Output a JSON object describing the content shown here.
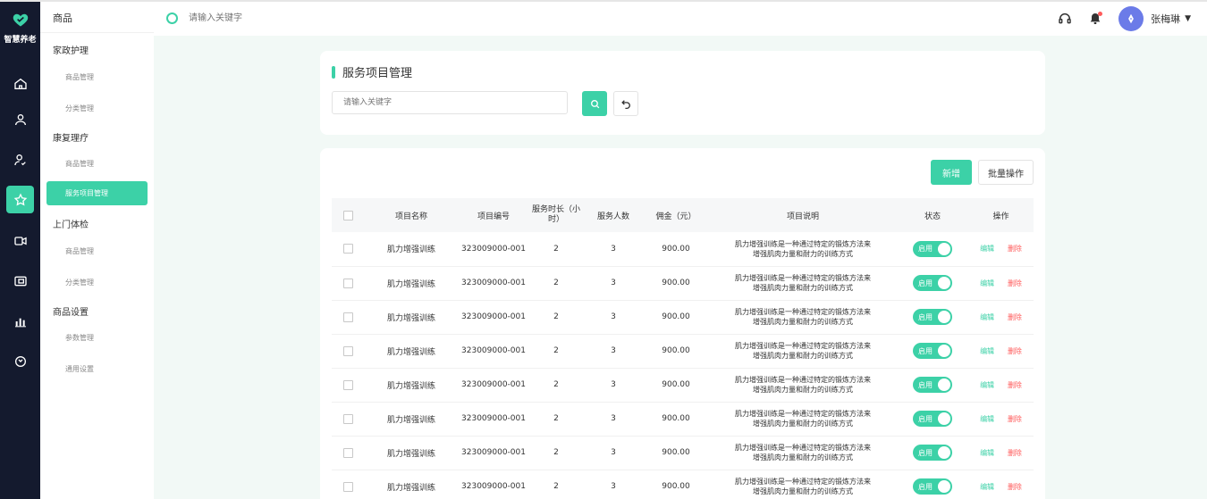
{
  "brand": {
    "name": "智慧养老"
  },
  "rail": {
    "items": [
      {
        "icon": "home-icon"
      },
      {
        "icon": "user-icon"
      },
      {
        "icon": "user-check-icon"
      },
      {
        "icon": "star-icon",
        "active": true
      },
      {
        "icon": "video-icon"
      },
      {
        "icon": "wallet-icon"
      },
      {
        "icon": "bar-chart-icon"
      },
      {
        "icon": "clock-icon"
      }
    ]
  },
  "submenu": {
    "title": "商品",
    "groups": [
      {
        "label": "家政护理",
        "items": [
          "商品管理",
          "分类管理"
        ]
      },
      {
        "label": "康复理疗",
        "items": [
          "商品管理",
          "服务项目管理"
        ]
      },
      {
        "label": "上门体检",
        "items": [
          "商品管理",
          "分类管理"
        ]
      },
      {
        "label": "商品设置",
        "items": [
          "参数管理",
          "通用设置"
        ]
      }
    ],
    "active_item": "服务项目管理"
  },
  "topbar": {
    "search_placeholder": "请输入关键字",
    "user_name": "张梅琳"
  },
  "filter": {
    "title": "服务项目管理",
    "keyword_placeholder": "请输入关键字"
  },
  "toolbar": {
    "add_label": "新增",
    "batch_label": "批量操作"
  },
  "table": {
    "headers": [
      "项目名称",
      "项目编号",
      "服务时长（小时）",
      "服务人数",
      "佣金（元）",
      "项目说明",
      "状态",
      "操作"
    ],
    "rows": [
      {
        "name": "肌力增强训练",
        "code": "323009000-001",
        "hours": "2",
        "people": "3",
        "fee": "900.00",
        "desc_line1": "肌力增强训练是一种通过特定的锻炼方法来",
        "desc_line2": "增强肌肉力量和耐力的训练方式",
        "status": "启用",
        "edit": "编辑",
        "delete": "删除"
      },
      {
        "name": "肌力增强训练",
        "code": "323009000-001",
        "hours": "2",
        "people": "3",
        "fee": "900.00",
        "desc_line1": "肌力增强训练是一种通过特定的锻炼方法来",
        "desc_line2": "增强肌肉力量和耐力的训练方式",
        "status": "启用",
        "edit": "编辑",
        "delete": "删除"
      },
      {
        "name": "肌力增强训练",
        "code": "323009000-001",
        "hours": "2",
        "people": "3",
        "fee": "900.00",
        "desc_line1": "肌力增强训练是一种通过特定的锻炼方法来",
        "desc_line2": "增强肌肉力量和耐力的训练方式",
        "status": "启用",
        "edit": "编辑",
        "delete": "删除"
      },
      {
        "name": "肌力增强训练",
        "code": "323009000-001",
        "hours": "2",
        "people": "3",
        "fee": "900.00",
        "desc_line1": "肌力增强训练是一种通过特定的锻炼方法来",
        "desc_line2": "增强肌肉力量和耐力的训练方式",
        "status": "启用",
        "edit": "编辑",
        "delete": "删除"
      },
      {
        "name": "肌力增强训练",
        "code": "323009000-001",
        "hours": "2",
        "people": "3",
        "fee": "900.00",
        "desc_line1": "肌力增强训练是一种通过特定的锻炼方法来",
        "desc_line2": "增强肌肉力量和耐力的训练方式",
        "status": "启用",
        "edit": "编辑",
        "delete": "删除"
      },
      {
        "name": "肌力增强训练",
        "code": "323009000-001",
        "hours": "2",
        "people": "3",
        "fee": "900.00",
        "desc_line1": "肌力增强训练是一种通过特定的锻炼方法来",
        "desc_line2": "增强肌肉力量和耐力的训练方式",
        "status": "启用",
        "edit": "编辑",
        "delete": "删除"
      },
      {
        "name": "肌力增强训练",
        "code": "323009000-001",
        "hours": "2",
        "people": "3",
        "fee": "900.00",
        "desc_line1": "肌力增强训练是一种通过特定的锻炼方法来",
        "desc_line2": "增强肌肉力量和耐力的训练方式",
        "status": "启用",
        "edit": "编辑",
        "delete": "删除"
      },
      {
        "name": "肌力增强训练",
        "code": "323009000-001",
        "hours": "2",
        "people": "3",
        "fee": "900.00",
        "desc_line1": "肌力增强训练是一种通过特定的锻炼方法来",
        "desc_line2": "增强肌肉力量和耐力的训练方式",
        "status": "启用",
        "edit": "编辑",
        "delete": "删除"
      }
    ]
  },
  "colors": {
    "accent": "#3cd1a7",
    "rail_bg": "#141a2e",
    "danger": "#ff5a5a",
    "avatar": "#6b7be8"
  }
}
